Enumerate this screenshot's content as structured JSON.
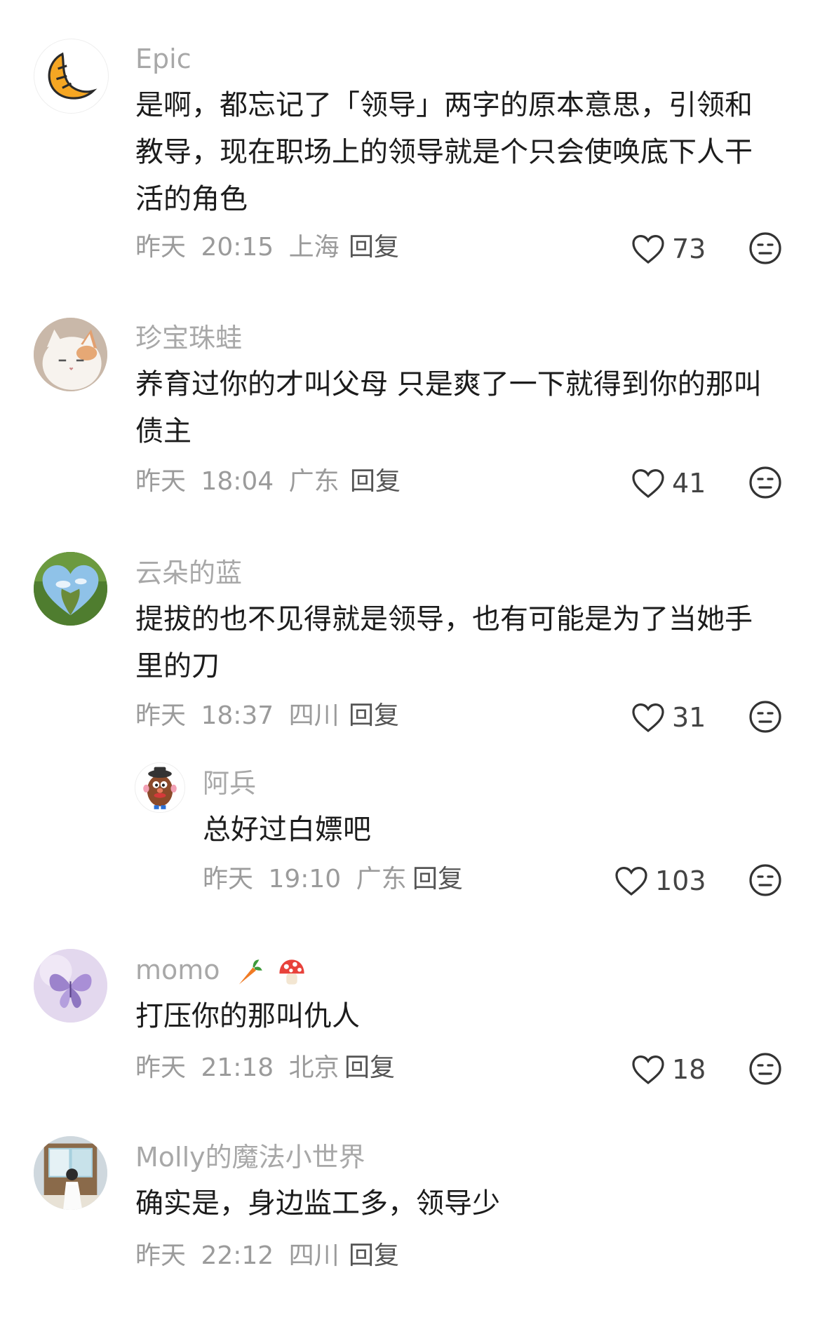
{
  "comments": [
    {
      "name": "Epic",
      "lines": [
        "是啊，都忘记了「领导」两字的原本意思，引领和",
        "教导，现在职场上的领导就是个只会使唤底下人干",
        "活的角色"
      ],
      "date": "昨天",
      "time": "20:15",
      "location": "上海",
      "reply": "回复",
      "likes": "73"
    },
    {
      "name": "珍宝珠蛙",
      "lines": [
        "养育过你的才叫父母 只是爽了一下就得到你的那叫",
        "债主"
      ],
      "date": "昨天",
      "time": "18:04",
      "location": "广东",
      "reply": "回复",
      "likes": "41"
    },
    {
      "name": "云朵的蓝",
      "lines": [
        "提拔的也不见得就是领导，也有可能是为了当她手",
        "里的刀"
      ],
      "date": "昨天",
      "time": "18:37",
      "location": "四川",
      "reply": "回复",
      "likes": "31"
    },
    {
      "name": "阿兵",
      "lines": [
        "总好过白嫖吧"
      ],
      "date": "昨天",
      "time": "19:10",
      "location": "广东",
      "reply": "回复",
      "likes": "103"
    },
    {
      "name": "momo",
      "lines": [
        "打压你的那叫仇人"
      ],
      "date": "昨天",
      "time": "21:18",
      "location": "北京",
      "reply": "回复",
      "likes": "18"
    },
    {
      "name": "Molly的魔法小世界",
      "lines": [
        "确实是，身边监工多，领导少"
      ],
      "date": "昨天",
      "time": "22:12",
      "location": "四川",
      "reply": "回复",
      "likes": ""
    }
  ],
  "icons": {
    "like": "heart-outline-icon",
    "dislike": "meh-face-icon"
  },
  "colors": {
    "name": "#a8a8a8",
    "text": "#1c1c1c",
    "meta": "#9b9b9b",
    "reply": "#555555"
  }
}
